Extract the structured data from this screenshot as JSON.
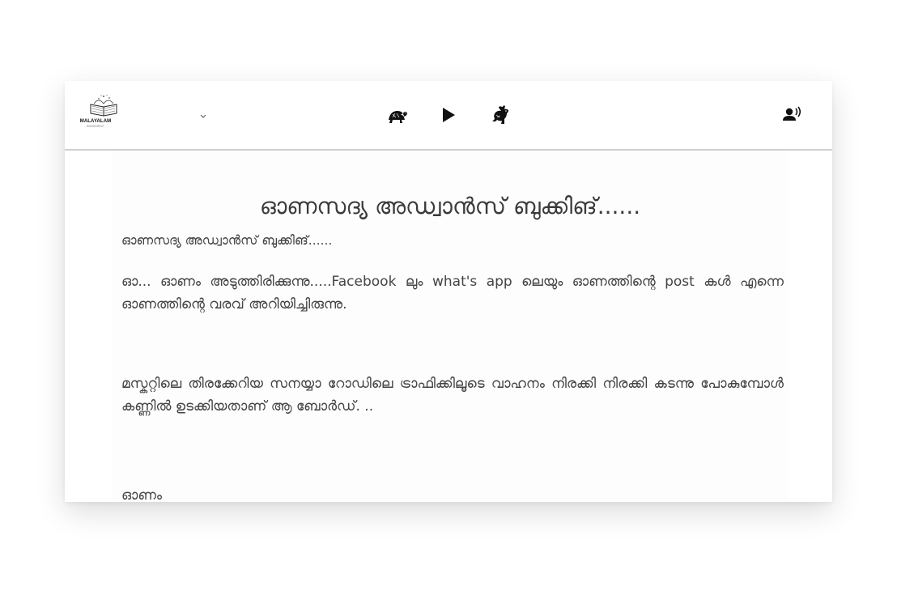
{
  "toolbar": {
    "logo_text": "MALAYALAM",
    "logo_subtext": "BOOKSHELF",
    "icons": [
      "tortoise-icon",
      "play-icon",
      "rabbit-icon",
      "speaker-person-icon"
    ]
  },
  "article": {
    "title": "ഓണസദ്യ അഡ്വാൻസ് ബുക്കിങ്......",
    "subtitle": "ഓണസദ്യ അഡ്വാൻസ് ബുക്കിങ്......",
    "paragraphs": [
      "ഓ... ഓണം അടുത്തിരിക്കുന്നു.....Facebook ലും what's app ലെയും ഓണത്തിന്റെ post കൾ എന്നെ ഓണത്തിന്റെ വരവ് അറിയിച്ചിരുന്നു.",
      "മസ്കറ്റിലെ തിരക്കേറിയ സനയ്യാ റോഡിലെ ട്രാഫിക്കിലൂടെ വാഹനം നിരക്കി നിരക്കി കടന്നു പോകുമ്പോൾ കണ്ണിൽ ഉടക്കിയതാണ് ആ ബോർഡ്. ..",
      "ഓണം"
    ]
  },
  "colors": {
    "text": "#444444",
    "divider": "#cfcfcf",
    "icon": "#111111"
  }
}
